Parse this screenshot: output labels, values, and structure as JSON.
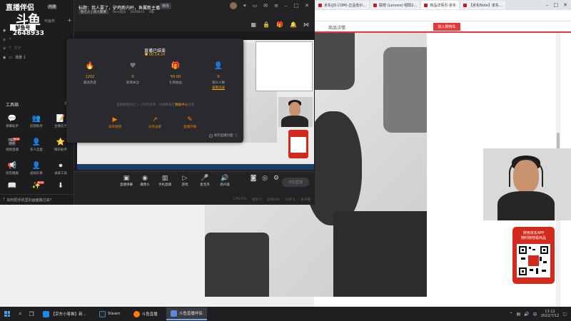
{
  "browser": {
    "tabs": [
      {
        "label": "京东(JD.COM)-正品低价..."
      },
      {
        "label": "联想 (Lenovo) 昭阳2..."
      },
      {
        "label": "商品详情页-京东"
      },
      {
        "label": "【京东Note】京东..."
      }
    ],
    "page_title": "商品详情",
    "add_cart_label": "加入购物车"
  },
  "promo": {
    "line1": "使用京东APP",
    "line2": "随时随地看商品"
  },
  "app": {
    "logo": "直播伴侣",
    "logo_big": "斗鱼",
    "version": "内测",
    "id_banner": "鲈鱼号",
    "user_id": "2648933",
    "scene_header": "可画布",
    "scenes": [
      {
        "label": "文字"
      },
      {
        "label": "场景 1"
      }
    ],
    "title": "标题：我人要了，驴鸡新内杆，鱼翼新主播",
    "title_edit": "修改",
    "info_tag": "晚七人 | 四人聚赛",
    "fans": "fans成员",
    "room_id": "2648933",
    "level": "2级",
    "tools_header": "工具箱",
    "tools": [
      {
        "label": "弹幕助手",
        "icon": "💬"
      },
      {
        "label": "房管助手",
        "icon": "👥"
      },
      {
        "label": "主播任务",
        "icon": "📝"
      },
      {
        "label": "视频直播",
        "icon": "🎬",
        "badge": "NEW"
      },
      {
        "label": "多人连麦",
        "icon": "👤"
      },
      {
        "label": "精彩助手",
        "icon": "⭐"
      },
      {
        "label": "语音播报",
        "icon": "📢"
      },
      {
        "label": "虚拟形象",
        "icon": "👤"
      },
      {
        "label": "录屏工具",
        "icon": "⏺"
      },
      {
        "label": "主播课堂",
        "icon": "📖"
      },
      {
        "label": "美颜设置",
        "icon": "✨",
        "badge": "NEW"
      },
      {
        "label": "更多",
        "icon": "⬇"
      }
    ],
    "help_text": "如何把手机里的画面搬过来？",
    "end_modal": {
      "title": "直播已结束",
      "time": "00:14:24",
      "stats": [
        {
          "value": "1202",
          "label": "最高热度",
          "icon": "🔥"
        },
        {
          "value": "0",
          "label": "新增关注",
          "icon": "♥"
        },
        {
          "value": "¥0.00",
          "label": "礼物收益",
          "icon": "🎁"
        },
        {
          "value": "0",
          "label": "观众人数",
          "icon": "👤",
          "link": "查看记录"
        }
      ],
      "note_prefix": "·直播数据会在 1 小时内更新 · 详细数据在",
      "note_link": "数据中心",
      "note_suffix": "查看",
      "actions": [
        {
          "label": "发布视频",
          "icon": "▶"
        },
        {
          "label": "分享战果",
          "icon": "↗"
        },
        {
          "label": "直播开播",
          "icon": "✎"
        }
      ],
      "keep_label": "保存直播封面"
    },
    "controls": [
      {
        "label": "直播弹幕",
        "icon": "▣"
      },
      {
        "label": "摄像头",
        "icon": "◉"
      },
      {
        "label": "手机直播",
        "icon": "▥"
      },
      {
        "label": "游戏",
        "icon": "▷"
      },
      {
        "label": "麦克风",
        "icon": "🎤"
      },
      {
        "label": "扬声器",
        "icon": "🔊"
      }
    ],
    "start_label": "开始直播",
    "status": [
      "CPU:0%",
      "帧率:0",
      "丢帧:0%",
      "码率:0",
      "未开播"
    ]
  },
  "taskbar": {
    "items": [
      {
        "label": "【京东小客推】新...",
        "color": "#1e88e5"
      },
      {
        "label": "Steam",
        "color": "#1b2838"
      },
      {
        "label": "斗鱼直播"
      },
      {
        "label": "斗鱼直播伴侣",
        "color": "#5b8bd9"
      }
    ],
    "time": "13:12",
    "date": "2022/7/12"
  }
}
